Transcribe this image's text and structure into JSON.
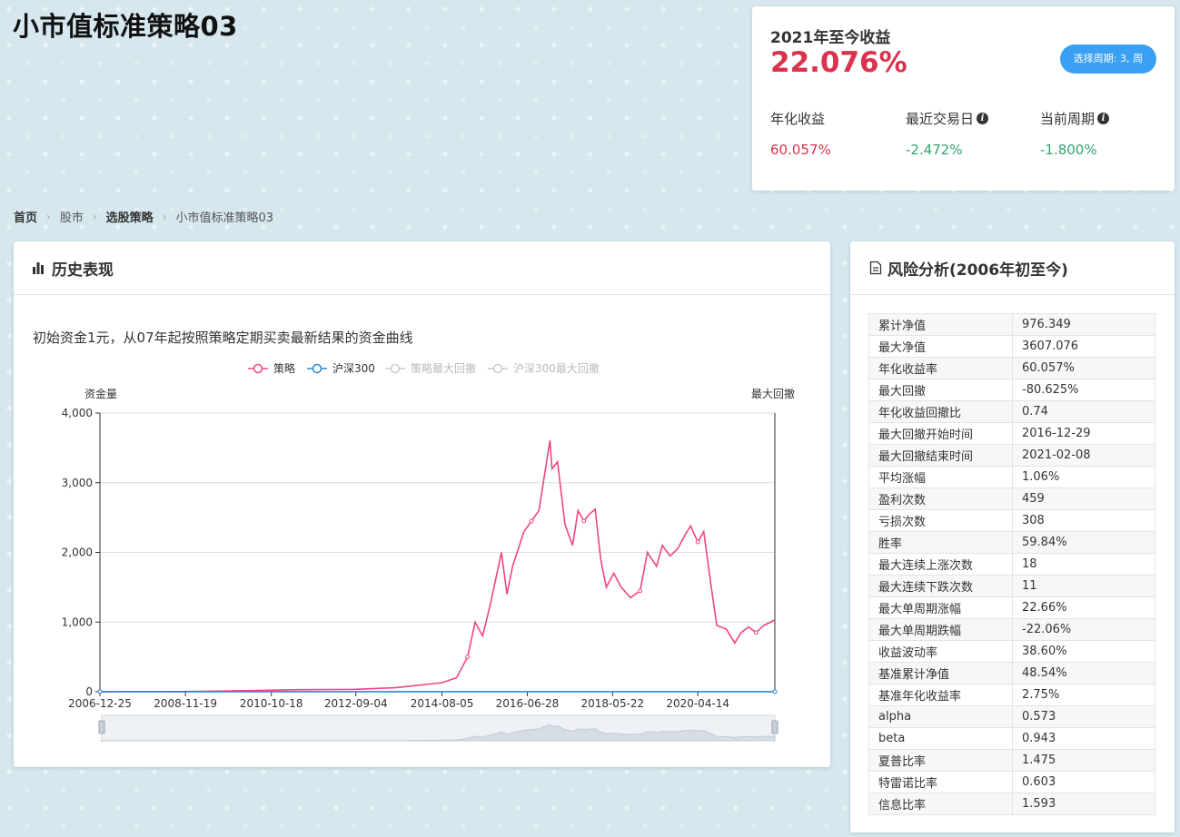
{
  "page": {
    "title": "小市值标准策略03"
  },
  "summary": {
    "ytd_label": "2021年至今收益",
    "ytd_value": "22.076%",
    "period_button": "选择周期: 3, 周",
    "metrics": [
      {
        "label": "年化收益",
        "value": "60.057%",
        "color": "#d9334d"
      },
      {
        "label": "最近交易日",
        "value": "-2.472%",
        "color": "#32a56a",
        "info": true
      },
      {
        "label": "当前周期",
        "value": "-1.800%",
        "color": "#32a56a",
        "info": true
      }
    ]
  },
  "breadcrumb": [
    {
      "label": "首页"
    },
    {
      "label": "股市"
    },
    {
      "label": "选股策略"
    },
    {
      "label": "小市值标准策略03"
    }
  ],
  "history": {
    "title": "历史表现",
    "description": "初始资金1元，从07年起按照策略定期买卖最新结果的资金曲线"
  },
  "chart_data": {
    "type": "line",
    "title": "",
    "ylabel": "资金量",
    "y2label": "最大回撤",
    "ylim": [
      0,
      4000
    ],
    "yticks": [
      "0",
      "1,000",
      "2,000",
      "3,000",
      "4,000"
    ],
    "xlim": [
      "2006-12-25",
      "2021-12-31"
    ],
    "xticks": [
      "2006-12-25",
      "2008-11-19",
      "2010-10-18",
      "2012-09-04",
      "2014-08-05",
      "2016-06-28",
      "2018-05-22",
      "2020-04-14"
    ],
    "legend": [
      "策略",
      "沪深300",
      "策略最大回撤",
      "沪深300最大回撤"
    ],
    "legend_position": "top-center",
    "grid": true,
    "series": [
      {
        "name": "策略",
        "color": "#f0477d",
        "points": [
          [
            "2006-12-25",
            1
          ],
          [
            "2008-11-19",
            3
          ],
          [
            "2010-10-18",
            22
          ],
          [
            "2011-06-01",
            30
          ],
          [
            "2012-09-04",
            35
          ],
          [
            "2013-08-01",
            60
          ],
          [
            "2014-08-05",
            130
          ],
          [
            "2014-12-01",
            200
          ],
          [
            "2015-03-01",
            500
          ],
          [
            "2015-05-01",
            1000
          ],
          [
            "2015-07-01",
            800
          ],
          [
            "2015-09-01",
            1250
          ],
          [
            "2015-12-01",
            2000
          ],
          [
            "2016-01-15",
            1400
          ],
          [
            "2016-03-01",
            1800
          ],
          [
            "2016-06-01",
            2300
          ],
          [
            "2016-08-01",
            2450
          ],
          [
            "2016-10-01",
            2600
          ],
          [
            "2016-12-29",
            3607
          ],
          [
            "2017-01-15",
            3200
          ],
          [
            "2017-03-01",
            3300
          ],
          [
            "2017-05-01",
            2400
          ],
          [
            "2017-07-01",
            2100
          ],
          [
            "2017-08-15",
            2600
          ],
          [
            "2017-10-01",
            2450
          ],
          [
            "2017-11-15",
            2550
          ],
          [
            "2018-01-01",
            2620
          ],
          [
            "2018-02-15",
            1900
          ],
          [
            "2018-04-01",
            1500
          ],
          [
            "2018-06-01",
            1700
          ],
          [
            "2018-08-01",
            1500
          ],
          [
            "2018-10-15",
            1350
          ],
          [
            "2019-01-01",
            1450
          ],
          [
            "2019-03-01",
            2000
          ],
          [
            "2019-05-15",
            1800
          ],
          [
            "2019-07-01",
            2100
          ],
          [
            "2019-09-01",
            1950
          ],
          [
            "2019-11-01",
            2050
          ],
          [
            "2020-01-01",
            2250
          ],
          [
            "2020-02-15",
            2380
          ],
          [
            "2020-04-14",
            2150
          ],
          [
            "2020-06-01",
            2300
          ],
          [
            "2020-08-01",
            1500
          ],
          [
            "2020-09-15",
            950
          ],
          [
            "2020-12-01",
            900
          ],
          [
            "2021-02-08",
            700
          ],
          [
            "2021-04-01",
            850
          ],
          [
            "2021-06-01",
            930
          ],
          [
            "2021-08-01",
            850
          ],
          [
            "2021-10-01",
            950
          ],
          [
            "2021-12-31",
            1030
          ]
        ]
      },
      {
        "name": "沪深300",
        "color": "#2f86cc",
        "points": [
          [
            "2006-12-25",
            1
          ],
          [
            "2021-12-31",
            1
          ]
        ]
      }
    ]
  },
  "risk": {
    "title": "风险分析(2006年初至今)",
    "rows": [
      [
        "累计净值",
        "976.349"
      ],
      [
        "最大净值",
        "3607.076"
      ],
      [
        "年化收益率",
        "60.057%"
      ],
      [
        "最大回撤",
        "-80.625%"
      ],
      [
        "年化收益回撤比",
        "0.74"
      ],
      [
        "最大回撤开始时间",
        "2016-12-29"
      ],
      [
        "最大回撤结束时间",
        "2021-02-08"
      ],
      [
        "平均涨幅",
        "1.06%"
      ],
      [
        "盈利次数",
        "459"
      ],
      [
        "亏损次数",
        "308"
      ],
      [
        "胜率",
        "59.84%"
      ],
      [
        "最大连续上涨次数",
        "18"
      ],
      [
        "最大连续下跌次数",
        "11"
      ],
      [
        "最大单周期涨幅",
        "22.66%"
      ],
      [
        "最大单周期跌幅",
        "-22.06%"
      ],
      [
        "收益波动率",
        "38.60%"
      ],
      [
        "基准累计净值",
        "48.54%"
      ],
      [
        "基准年化收益率",
        "2.75%"
      ],
      [
        "alpha",
        "0.573"
      ],
      [
        "beta",
        "0.943"
      ],
      [
        "夏普比率",
        "1.475"
      ],
      [
        "特雷诺比率",
        "0.603"
      ],
      [
        "信息比率",
        "1.593"
      ]
    ]
  }
}
